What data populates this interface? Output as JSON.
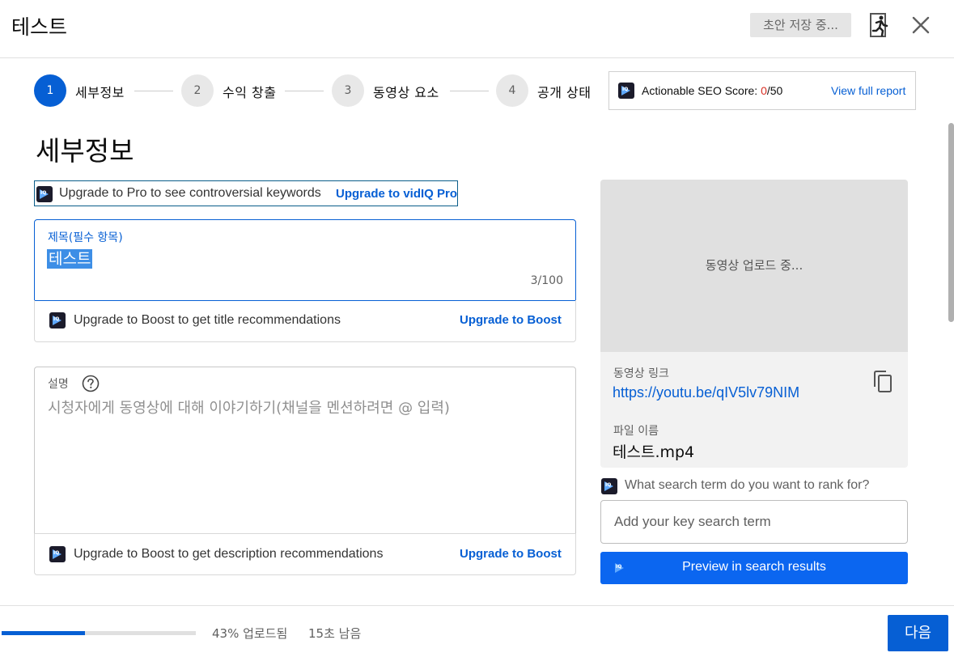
{
  "header": {
    "title": "테스트",
    "draft_status": "초안 저장 중..."
  },
  "stepper": {
    "steps": [
      {
        "number": "1",
        "label": "세부정보",
        "active": true
      },
      {
        "number": "2",
        "label": "수익 창출",
        "active": false
      },
      {
        "number": "3",
        "label": "동영상 요소",
        "active": false
      },
      {
        "number": "4",
        "label": "공개 상태",
        "active": false
      }
    ]
  },
  "seo": {
    "label": "Actionable SEO Score:",
    "score": "0",
    "max": "/50",
    "link": "View full report",
    "score_color": "#d93025"
  },
  "main": {
    "section_title": "세부정보",
    "pro_banner": {
      "text": "Upgrade to Pro to see controversial keywords",
      "link": "Upgrade to vidIQ Pro"
    },
    "title_field": {
      "label": "제목(필수 항목)",
      "value": "테스트",
      "counter": "3/100"
    },
    "title_boost": {
      "text": "Upgrade to Boost to get title recommendations",
      "link": "Upgrade to Boost"
    },
    "description_field": {
      "label": "설명",
      "placeholder": "시청자에게 동영상에 대해 이야기하기(채널을 멘션하려면 @ 입력)"
    },
    "description_boost": {
      "text": "Upgrade to Boost to get description recommendations",
      "link": "Upgrade to Boost"
    }
  },
  "side": {
    "preview_status": "동영상 업로드 중...",
    "video_link_label": "동영상 링크",
    "video_link": "https://youtu.be/qIV5lv79NIM",
    "filename_label": "파일 이름",
    "filename": "테스트.mp4",
    "search_term_question": "What search term do you want to rank for?",
    "search_term_placeholder": "Add your key search term",
    "preview_button": "Preview in search results"
  },
  "footer": {
    "progress_fraction": 0.43,
    "progress_text": "43% 업로드됨",
    "time_left": "15초 남음",
    "next_button": "다음"
  },
  "colors": {
    "accent": "#065fd4",
    "preview_button": "#0b66f0"
  }
}
